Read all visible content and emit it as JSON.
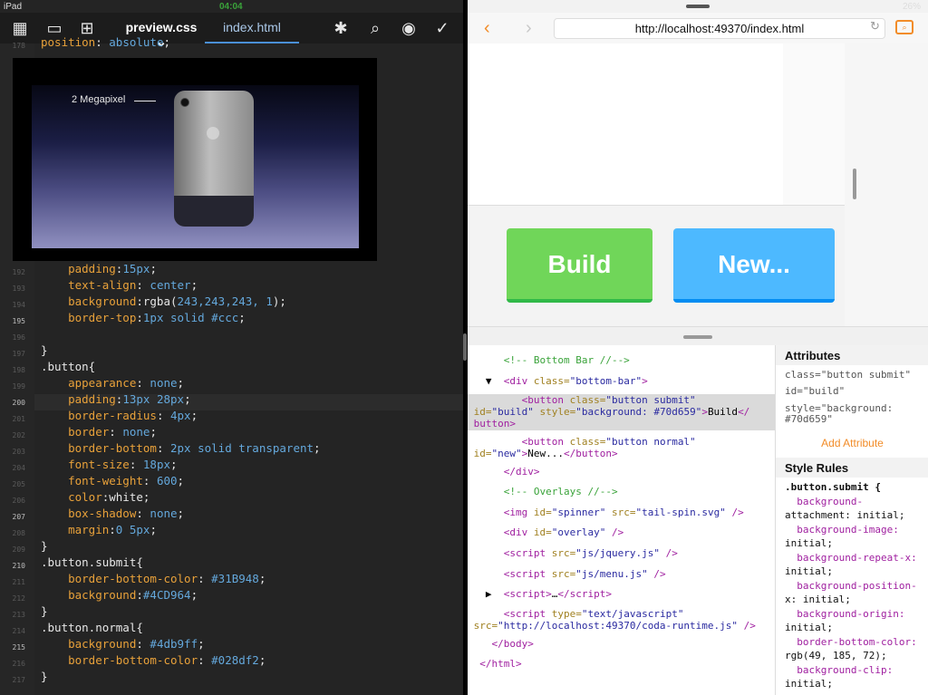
{
  "status": {
    "device": "iPad",
    "time": "04:04",
    "battery": "26%"
  },
  "left": {
    "tabs": [
      {
        "label": "preview.css",
        "active": true
      },
      {
        "label": "index.html",
        "active": false
      }
    ],
    "overlay": {
      "label": "2 Megapixel"
    },
    "gutter": [
      "178",
      "192",
      "193",
      "194",
      "195",
      "196",
      "197",
      "198",
      "199",
      "200",
      "201",
      "202",
      "203",
      "204",
      "205",
      "206",
      "207",
      "208",
      "209",
      "210",
      "211",
      "212",
      "213",
      "214",
      "215",
      "216",
      "217"
    ],
    "code": [
      {
        "parts": [
          {
            "cls": "p",
            "t": "position"
          },
          {
            "cls": "w",
            "t": ": "
          },
          {
            "cls": "v",
            "t": "absolute"
          },
          {
            "cls": "w",
            "t": ";"
          }
        ]
      },
      {
        "parts": [
          {
            "cls": "p",
            "t": "    padding"
          },
          {
            "cls": "w",
            "t": ":"
          },
          {
            "cls": "n",
            "t": "15px"
          },
          {
            "cls": "w",
            "t": ";"
          }
        ]
      },
      {
        "parts": [
          {
            "cls": "p",
            "t": "    text-align"
          },
          {
            "cls": "w",
            "t": ": "
          },
          {
            "cls": "v",
            "t": "center"
          },
          {
            "cls": "w",
            "t": ";"
          }
        ]
      },
      {
        "parts": [
          {
            "cls": "p",
            "t": "    background"
          },
          {
            "cls": "w",
            "t": ":rgba("
          },
          {
            "cls": "n",
            "t": "243,243,243, 1"
          },
          {
            "cls": "w",
            "t": ");"
          }
        ]
      },
      {
        "parts": [
          {
            "cls": "p",
            "t": "    border-top"
          },
          {
            "cls": "w",
            "t": ":"
          },
          {
            "cls": "n",
            "t": "1px"
          },
          {
            "cls": "v",
            "t": " solid #ccc"
          },
          {
            "cls": "w",
            "t": ";"
          }
        ]
      },
      {
        "parts": [
          {
            "cls": "w",
            "t": ""
          }
        ]
      },
      {
        "parts": [
          {
            "cls": "w",
            "t": "}"
          }
        ]
      },
      {
        "parts": [
          {
            "cls": "w",
            "t": ".button{"
          }
        ]
      },
      {
        "parts": [
          {
            "cls": "p",
            "t": "    appearance"
          },
          {
            "cls": "w",
            "t": ": "
          },
          {
            "cls": "v",
            "t": "none"
          },
          {
            "cls": "w",
            "t": ";"
          }
        ]
      },
      {
        "parts": [
          {
            "cls": "p",
            "t": "    padding"
          },
          {
            "cls": "w",
            "t": ":"
          },
          {
            "cls": "n",
            "t": "13px 28px"
          },
          {
            "cls": "w",
            "t": ";"
          }
        ]
      },
      {
        "parts": [
          {
            "cls": "p",
            "t": "    border-radius"
          },
          {
            "cls": "w",
            "t": ": "
          },
          {
            "cls": "n",
            "t": "4px"
          },
          {
            "cls": "w",
            "t": ";"
          }
        ]
      },
      {
        "parts": [
          {
            "cls": "p",
            "t": "    border"
          },
          {
            "cls": "w",
            "t": ": "
          },
          {
            "cls": "v",
            "t": "none"
          },
          {
            "cls": "w",
            "t": ";"
          }
        ]
      },
      {
        "parts": [
          {
            "cls": "p",
            "t": "    border-bottom"
          },
          {
            "cls": "w",
            "t": ": "
          },
          {
            "cls": "n",
            "t": "2px"
          },
          {
            "cls": "v",
            "t": " solid transparent"
          },
          {
            "cls": "w",
            "t": ";"
          }
        ]
      },
      {
        "parts": [
          {
            "cls": "p",
            "t": "    font-size"
          },
          {
            "cls": "w",
            "t": ": "
          },
          {
            "cls": "n",
            "t": "18px"
          },
          {
            "cls": "w",
            "t": ";"
          }
        ]
      },
      {
        "parts": [
          {
            "cls": "p",
            "t": "    font-weight"
          },
          {
            "cls": "w",
            "t": ": "
          },
          {
            "cls": "n",
            "t": "600"
          },
          {
            "cls": "w",
            "t": ";"
          }
        ]
      },
      {
        "parts": [
          {
            "cls": "p",
            "t": "    color"
          },
          {
            "cls": "w",
            "t": ":white;"
          }
        ]
      },
      {
        "parts": [
          {
            "cls": "p",
            "t": "    box-shadow"
          },
          {
            "cls": "w",
            "t": ": "
          },
          {
            "cls": "v",
            "t": "none"
          },
          {
            "cls": "w",
            "t": ";"
          }
        ]
      },
      {
        "parts": [
          {
            "cls": "p",
            "t": "    margin"
          },
          {
            "cls": "w",
            "t": ":"
          },
          {
            "cls": "n",
            "t": "0 5px"
          },
          {
            "cls": "w",
            "t": ";"
          }
        ]
      },
      {
        "parts": [
          {
            "cls": "w",
            "t": "}"
          }
        ]
      },
      {
        "parts": [
          {
            "cls": "w",
            "t": ".button.submit{"
          }
        ]
      },
      {
        "parts": [
          {
            "cls": "p",
            "t": "    border-bottom-color"
          },
          {
            "cls": "w",
            "t": ": "
          },
          {
            "cls": "n",
            "t": "#31B948"
          },
          {
            "cls": "w",
            "t": ";"
          }
        ]
      },
      {
        "parts": [
          {
            "cls": "p",
            "t": "    background"
          },
          {
            "cls": "w",
            "t": ":"
          },
          {
            "cls": "n",
            "t": "#4CD964"
          },
          {
            "cls": "w",
            "t": ";"
          }
        ]
      },
      {
        "parts": [
          {
            "cls": "w",
            "t": "}"
          }
        ]
      },
      {
        "parts": [
          {
            "cls": "w",
            "t": ".button.normal{"
          }
        ]
      },
      {
        "parts": [
          {
            "cls": "p",
            "t": "    background"
          },
          {
            "cls": "w",
            "t": ": "
          },
          {
            "cls": "n",
            "t": "#4db9ff"
          },
          {
            "cls": "w",
            "t": ";"
          }
        ]
      },
      {
        "parts": [
          {
            "cls": "p",
            "t": "    border-bottom-color"
          },
          {
            "cls": "w",
            "t": ": "
          },
          {
            "cls": "n",
            "t": "#028df2"
          },
          {
            "cls": "w",
            "t": ";"
          }
        ]
      },
      {
        "parts": [
          {
            "cls": "w",
            "t": "}"
          }
        ]
      }
    ]
  },
  "right": {
    "url": "http://localhost:49370/index.html",
    "buttons": {
      "build": "Build",
      "new": "New..."
    },
    "dom": [
      {
        "cls": "c",
        "t": "      <!-- Bottom Bar //-->"
      },
      {
        "html": "   ▼  <span class='t'>&lt;div</span> <span class='a'>class=</span><span class='s'>\"bottom-bar\"</span><span class='t'>&gt;</span>"
      },
      {
        "html": "         <span class='t'>&lt;button</span> <span class='a'>class=</span><span class='s'>\"button submit\"</span>",
        "sel": true
      },
      {
        "html": " <span class='a'>id=</span><span class='s'>\"build\"</span> <span class='a'>style=</span><span class='s'>\"background: #70d659\"</span><span class='t'>&gt;</span>Build<span class='t'>&lt;/</span>",
        "sel": true
      },
      {
        "html": " <span class='t'>button&gt;</span>",
        "sel": true
      },
      {
        "html": "         <span class='t'>&lt;button</span> <span class='a'>class=</span><span class='s'>\"button normal\"</span>"
      },
      {
        "html": " <span class='a'>id=</span><span class='s'>\"new\"</span><span class='t'>&gt;</span>New...<span class='t'>&lt;/button&gt;</span>"
      },
      {
        "html": "      <span class='t'>&lt;/div&gt;</span>"
      },
      {
        "cls": "c",
        "t": "      <!-- Overlays //-->"
      },
      {
        "html": "      <span class='t'>&lt;img</span> <span class='a'>id=</span><span class='s'>\"spinner\"</span> <span class='a'>src=</span><span class='s'>\"tail-spin.svg\"</span> <span class='t'>/&gt;</span>"
      },
      {
        "html": "      <span class='t'>&lt;div</span> <span class='a'>id=</span><span class='s'>\"overlay\"</span> <span class='t'>/&gt;</span>"
      },
      {
        "html": "      <span class='t'>&lt;script</span> <span class='a'>src=</span><span class='s'>\"js/jquery.js\"</span> <span class='t'>/&gt;</span>"
      },
      {
        "html": "      <span class='t'>&lt;script</span> <span class='a'>src=</span><span class='s'>\"js/menu.js\"</span> <span class='t'>/&gt;</span>"
      },
      {
        "html": "   ▶  <span class='t'>&lt;script&gt;</span>…<span class='t'>&lt;/script&gt;</span>"
      },
      {
        "html": "      <span class='t'>&lt;script</span> <span class='a'>type=</span><span class='s'>\"text/javascript\"</span>"
      },
      {
        "html": " <span class='a'>src=</span><span class='s'>\"http://localhost:49370/coda-runtime.js\"</span> <span class='t'>/&gt;</span>"
      },
      {
        "html": "    <span class='t'>&lt;/body&gt;</span>"
      },
      {
        "html": "  <span class='t'>&lt;/html&gt;</span>"
      }
    ],
    "attributes": {
      "title": "Attributes",
      "items": [
        "class=\"button submit\"",
        "id=\"build\"",
        "style=\"background:",
        "#70d659\""
      ],
      "add": "Add Attribute",
      "rules_title": "Style Rules",
      "rules": [
        ".button.submit {",
        "  background-",
        "attachment: initial;",
        "  background-image:",
        "initial;",
        "  background-repeat-x:",
        "initial;",
        "  background-position-",
        "x: initial;",
        "  background-origin:",
        "initial;",
        "  border-bottom-color:",
        "rgb(49, 185, 72);",
        "  background-clip:",
        "initial;"
      ]
    }
  }
}
